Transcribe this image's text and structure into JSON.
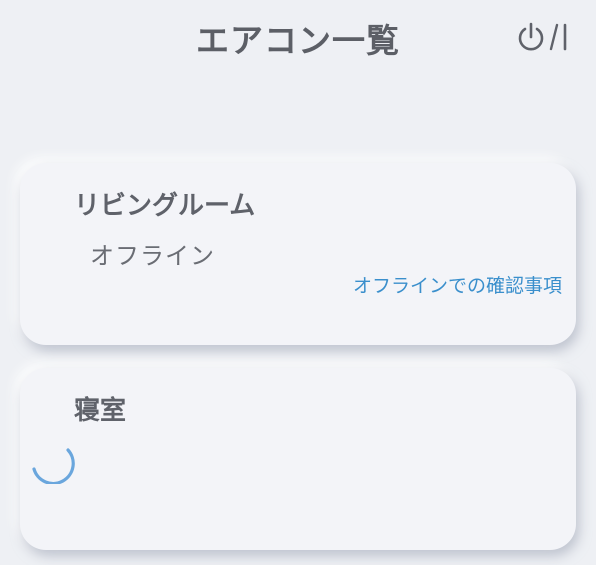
{
  "header": {
    "title": "エアコン一覧",
    "power_icon": "power-toggle-icon"
  },
  "units": [
    {
      "name": "リビングルーム",
      "status": "オフライン",
      "link": "オフラインでの確認事項"
    },
    {
      "name": "寝室",
      "loading_icon": "loading-spinner-icon"
    }
  ],
  "colors": {
    "background": "#eef0f4",
    "card": "#f3f4f8",
    "text": "#5f626a",
    "link": "#3a8fcc",
    "spinner": "#6aa6dd"
  }
}
